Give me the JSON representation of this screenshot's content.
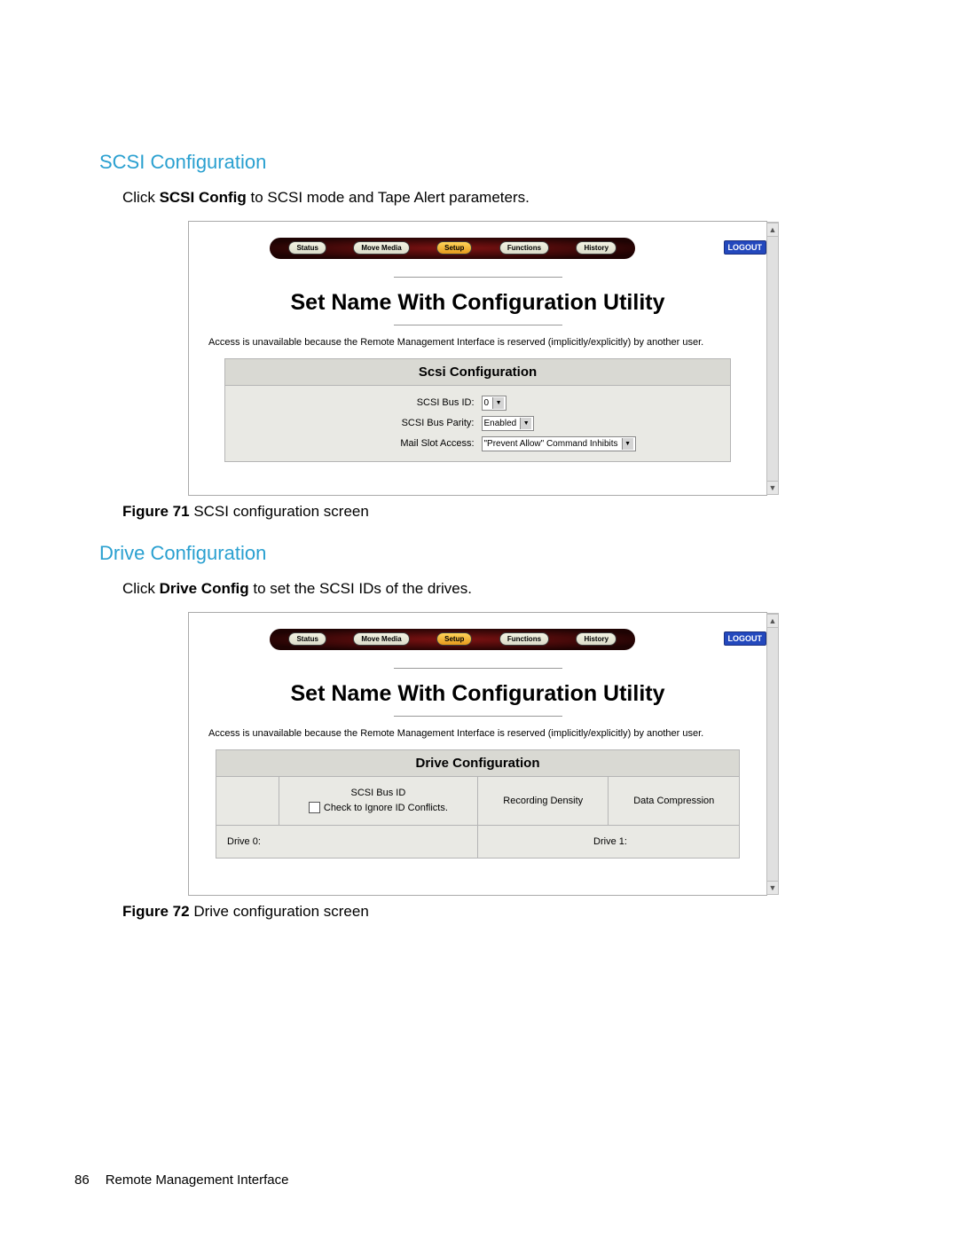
{
  "headings": {
    "scsi": "SCSI Configuration",
    "drive": "Drive Configuration"
  },
  "paragraphs": {
    "scsi_pre": "Click ",
    "scsi_bold": "SCSI Config",
    "scsi_post": " to SCSI mode and Tape Alert parameters.",
    "drive_pre": "Click ",
    "drive_bold": "Drive Config",
    "drive_post": " to set the SCSI IDs of the drives."
  },
  "captions": {
    "fig71_label": "Figure 71",
    "fig71_text": " SCSI configuration screen",
    "fig72_label": "Figure 72",
    "fig72_text": " Drive configuration screen"
  },
  "nav": {
    "items": [
      "Status",
      "Move Media",
      "Setup",
      "Functions",
      "History"
    ],
    "active_index": 2,
    "logout": "LOGOUT"
  },
  "shot_title": "Set Name With Configuration Utility",
  "access_note": "Access is unavailable because the Remote Management Interface is reserved (implicitly/explicitly) by another user.",
  "scsi_box": {
    "header": "Scsi Configuration",
    "rows": [
      {
        "label": "SCSI Bus ID:",
        "value": "0"
      },
      {
        "label": "SCSI Bus Parity:",
        "value": "Enabled"
      },
      {
        "label": "Mail Slot Access:",
        "value": "\"Prevent Allow\" Command Inhibits"
      }
    ]
  },
  "drive_box": {
    "header": "Drive Configuration",
    "cols": [
      "SCSI Bus ID",
      "Recording Density",
      "Data Compression"
    ],
    "check_label": "Check to Ignore ID Conflicts.",
    "drive0": "Drive 0:",
    "drive1": "Drive 1:"
  },
  "footer": {
    "page": "86",
    "section": "Remote Management Interface"
  }
}
